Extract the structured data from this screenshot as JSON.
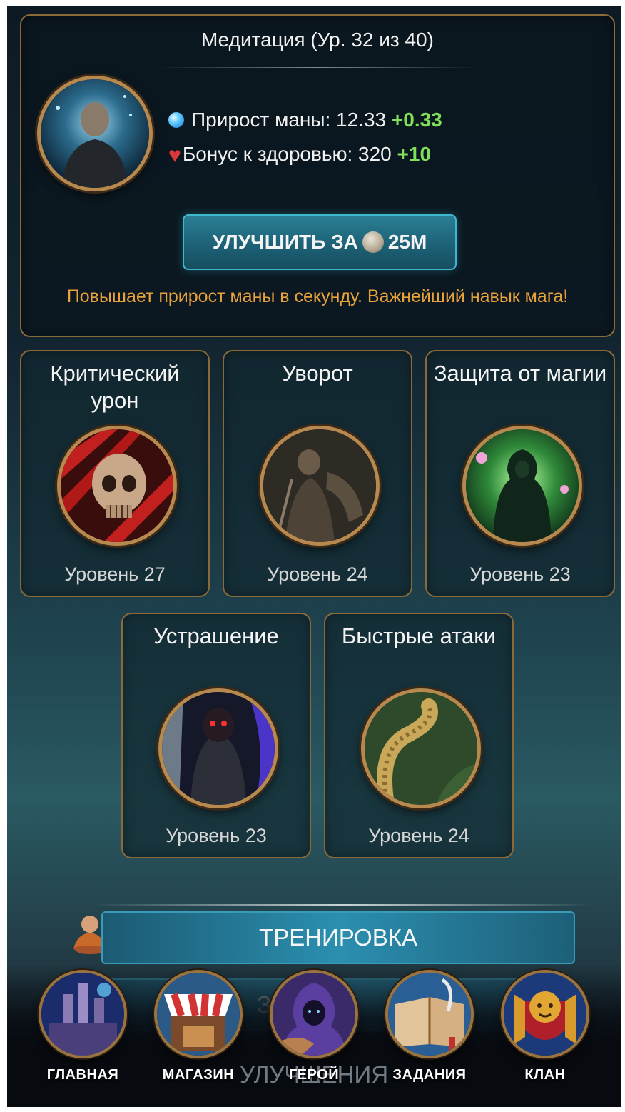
{
  "meditation": {
    "title": "Медитация (Ур. 32 из 40)",
    "mana_label": "Прирост маны: 12.33",
    "mana_bonus": "+0.33",
    "health_label": "Бонус к здоровью: 320",
    "health_bonus": "+10",
    "upgrade_prefix": "УЛУЧШИТЬ ЗА",
    "upgrade_cost": "25M",
    "description": "Повышает прирост маны в секунду. Важнейший навык мага!",
    "portrait_icon": "monk-portrait-icon"
  },
  "skills": [
    {
      "title": "Критический урон",
      "level": "Уровень 27",
      "icon": "skull-icon"
    },
    {
      "title": "Уворот",
      "level": "Уровень 24",
      "icon": "rogue-icon"
    },
    {
      "title": "Защита от магии",
      "level": "Уровень 23",
      "icon": "green-mage-icon"
    },
    {
      "title": "Устрашение",
      "level": "Уровень 23",
      "icon": "dark-knight-icon"
    },
    {
      "title": "Быстрые атаки",
      "level": "Уровень 24",
      "icon": "serpent-icon"
    }
  ],
  "actions": {
    "training": "ТРЕНИРОВКА",
    "tasks_partial": "ЗА",
    "tasks_partial_tail": "НИ",
    "upgrades_ghost": "УЛУЧШЕНИЯ"
  },
  "nav": {
    "items": [
      {
        "label": "ГЛАВНАЯ",
        "icon": "castle-icon"
      },
      {
        "label": "МАГАЗИН",
        "icon": "shop-icon"
      },
      {
        "label": "ГЕРОЙ",
        "icon": "hooded-hero-icon"
      },
      {
        "label": "ЗАДАНИЯ",
        "icon": "book-icon"
      },
      {
        "label": "КЛАН",
        "icon": "lion-crest-icon"
      }
    ]
  },
  "colors": {
    "accent_gold": "#8a6a38",
    "bonus_green": "#7fe05a",
    "desc_orange": "#e8a23a",
    "button_teal": "#1c5f74"
  }
}
